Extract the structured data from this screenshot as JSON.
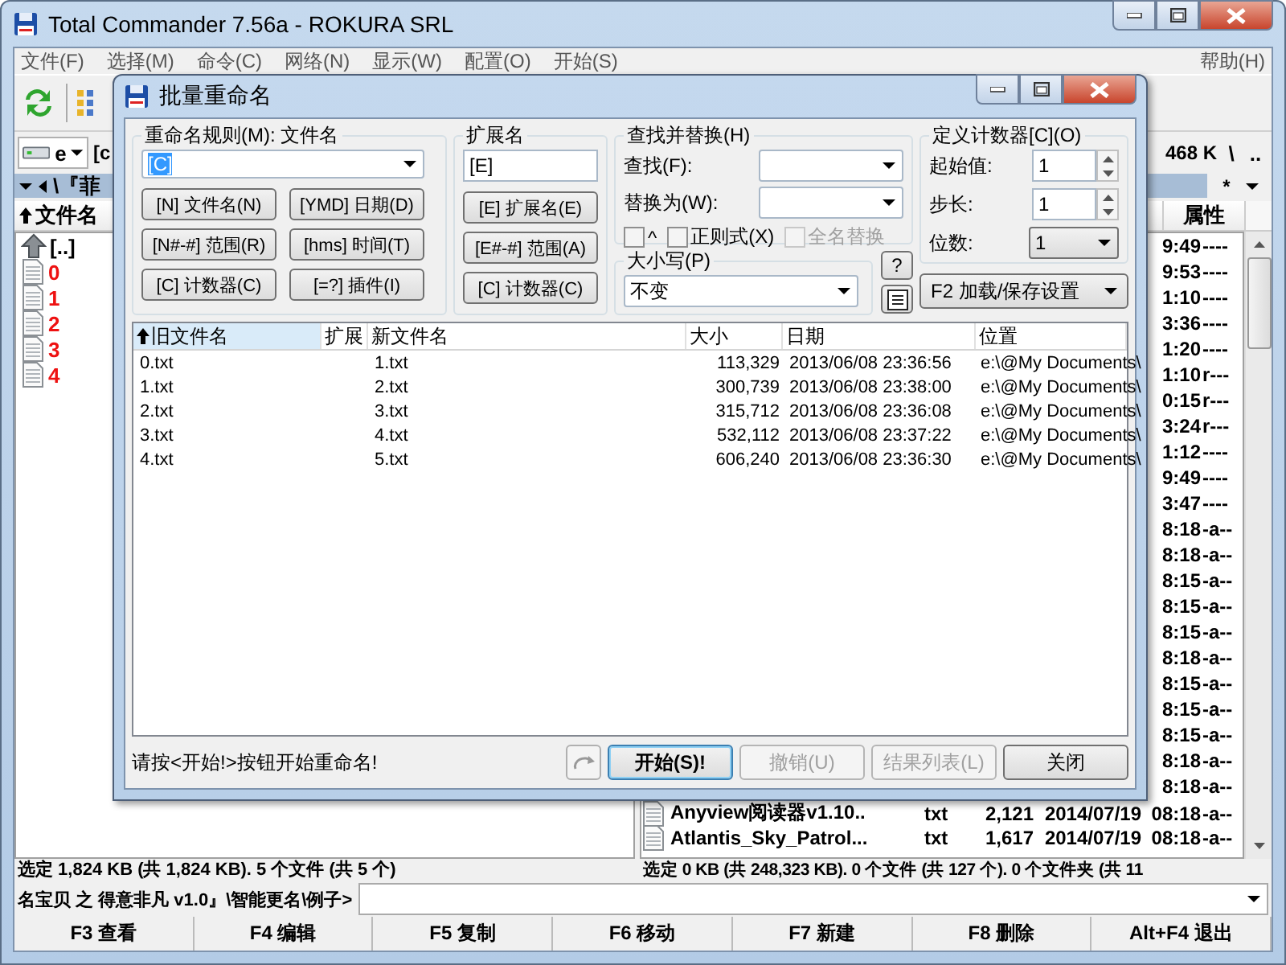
{
  "window": {
    "title": "Total Commander 7.56a - ROKURA SRL"
  },
  "menu": {
    "items": [
      "文件(F)",
      "选择(M)",
      "命令(C)",
      "网络(N)",
      "显示(W)",
      "配置(O)",
      "开始(S)"
    ],
    "help": "帮助(H)"
  },
  "left_panel": {
    "drive": "e",
    "drive_info": "[c",
    "path": "\\『菲",
    "column": {
      "label": "文件名",
      "sorted": true
    },
    "files": [
      {
        "name": "[..]",
        "kind": "parent"
      },
      {
        "name": "0",
        "kind": "file"
      },
      {
        "name": "1",
        "kind": "file"
      },
      {
        "name": "2",
        "kind": "file"
      },
      {
        "name": "3",
        "kind": "file"
      },
      {
        "name": "4",
        "kind": "file"
      }
    ],
    "status": "选定 1,824 KB (共 1,824 KB). 5 个文件 (共 5 个)"
  },
  "right_panel": {
    "free_space": "468 K",
    "nav_buttons": [
      "\\",
      ".."
    ],
    "filter": "*",
    "column": "属性",
    "files": [
      {
        "time": "9:49",
        "attrs": "----"
      },
      {
        "time": "9:53",
        "attrs": "----"
      },
      {
        "time": "1:10",
        "attrs": "----"
      },
      {
        "time": "3:36",
        "attrs": "----"
      },
      {
        "time": "1:20",
        "attrs": "----"
      },
      {
        "time": "1:10",
        "attrs": "r---"
      },
      {
        "time": "0:15",
        "attrs": "r---"
      },
      {
        "time": "3:24",
        "attrs": "r---"
      },
      {
        "time": "1:12",
        "attrs": "----"
      },
      {
        "time": "9:49",
        "attrs": "----"
      },
      {
        "time": "3:47",
        "attrs": "----"
      },
      {
        "time": "8:18",
        "attrs": "-a--"
      },
      {
        "time": "8:18",
        "attrs": "-a--"
      },
      {
        "time": "8:15",
        "attrs": "-a--"
      },
      {
        "time": "8:15",
        "attrs": "-a--"
      },
      {
        "time": "8:15",
        "attrs": "-a--"
      },
      {
        "time": "8:18",
        "attrs": "-a--"
      },
      {
        "time": "8:15",
        "attrs": "-a--"
      },
      {
        "time": "8:15",
        "attrs": "-a--"
      },
      {
        "time": "8:15",
        "attrs": "-a--"
      },
      {
        "time": "8:18",
        "attrs": "-a--"
      },
      {
        "time": "8:18",
        "attrs": "-a--"
      },
      {
        "name": "Anyview阅读器v1.10..",
        "ext": "txt",
        "size": "2,121",
        "date": "2014/07/19",
        "time": "08:18",
        "attrs": "-a--"
      },
      {
        "name": "Atlantis_Sky_Patrol...",
        "ext": "txt",
        "size": "1,617",
        "date": "2014/07/19",
        "time": "08:18",
        "attrs": "-a--"
      }
    ],
    "status": "选定 0 KB (共 248,323 KB). 0 个文件 (共 127 个). 0 个文件夹 (共 11"
  },
  "command_line": {
    "path": "名宝贝 之 得意非凡 v1.0』\\智能更名\\例子>"
  },
  "function_keys": [
    "F3 查看",
    "F4 编辑",
    "F5 复制",
    "F6 移动",
    "F7 新建",
    "F8 删除",
    "Alt+F4 退出"
  ],
  "dialog": {
    "title": "批量重命名",
    "name_rule": {
      "label": "重命名规则(M): 文件名",
      "value": "[C]",
      "value_selected": true,
      "buttons": [
        "[N] 文件名(N)",
        "[YMD] 日期(D)",
        "[N#-#] 范围(R)",
        "[hms] 时间(T)",
        "[C] 计数器(C)",
        "[=?] 插件(I)"
      ]
    },
    "extension": {
      "label": "扩展名",
      "value": "[E]",
      "buttons": [
        "[E] 扩展名(E)",
        "[E#-#] 范围(A)",
        "[C] 计数器(C)"
      ]
    },
    "search_replace": {
      "label": "查找并替换(H)",
      "find_label": "查找(F):",
      "replace_label": "替换为(W):",
      "options": [
        {
          "label": "^",
          "checked": false,
          "disabled": false
        },
        {
          "label": "正则式(X)",
          "checked": false,
          "disabled": false
        },
        {
          "label": "全名替换",
          "checked": false,
          "disabled": true
        }
      ]
    },
    "case": {
      "label": "大小写(P)",
      "value": "不变"
    },
    "help_button": "?",
    "counter": {
      "label": "定义计数器[C](O)",
      "start_label": "起始值:",
      "start": "1",
      "step_label": "步长:",
      "step": "1",
      "digits_label": "位数:",
      "digits": "1"
    },
    "settings_button": "F2 加载/保存设置",
    "list": {
      "columns": [
        {
          "label": "旧文件名",
          "sorted": true
        },
        {
          "label": "扩展",
          "sorted": false
        },
        {
          "label": "新文件名",
          "sorted": false
        },
        {
          "label": "大小",
          "sorted": false
        },
        {
          "label": "日期",
          "sorted": false
        },
        {
          "label": "位置",
          "sorted": false
        }
      ],
      "rows": [
        {
          "old": "0.txt",
          "new": "1.txt",
          "size": "113,329",
          "date": "2013/06/08 23:36:56",
          "location": "e:\\@My Documents\\"
        },
        {
          "old": "1.txt",
          "new": "2.txt",
          "size": "300,739",
          "date": "2013/06/08 23:38:00",
          "location": "e:\\@My Documents\\"
        },
        {
          "old": "2.txt",
          "new": "3.txt",
          "size": "315,712",
          "date": "2013/06/08 23:36:08",
          "location": "e:\\@My Documents\\"
        },
        {
          "old": "3.txt",
          "new": "4.txt",
          "size": "532,112",
          "date": "2013/06/08 23:37:22",
          "location": "e:\\@My Documents\\"
        },
        {
          "old": "4.txt",
          "new": "5.txt",
          "size": "606,240",
          "date": "2013/06/08 23:36:30",
          "location": "e:\\@My Documents\\"
        }
      ]
    },
    "message": "请按<开始!>按钮开始重命名!",
    "buttons": [
      {
        "label": "开始(S)!",
        "kind": "default",
        "disabled": false
      },
      {
        "label": "撤销(U)",
        "kind": "normal",
        "disabled": true
      },
      {
        "label": "结果列表(L)",
        "kind": "normal",
        "disabled": true
      },
      {
        "label": "关闭",
        "kind": "normal",
        "disabled": false
      }
    ]
  }
}
